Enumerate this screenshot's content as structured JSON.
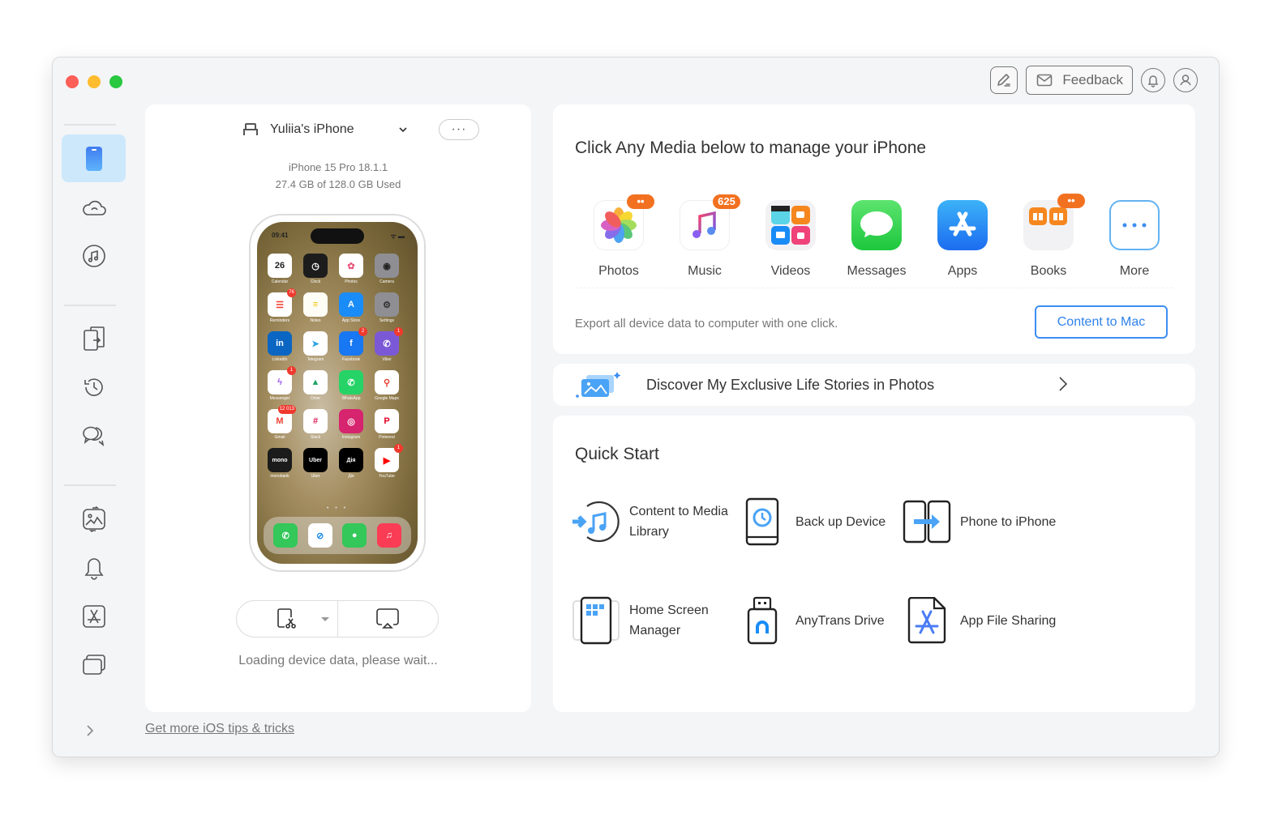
{
  "window": {
    "controls": [
      "close",
      "minimize",
      "maximize"
    ]
  },
  "toolbar": {
    "edit_icon": "edit-note-icon",
    "feedback_label": "Feedback",
    "feedback_icon": "mail-icon",
    "notifications_icon": "bell-icon",
    "account_icon": "user-icon"
  },
  "sidebar": {
    "items": [
      {
        "id": "device-manager",
        "icon": "phone-icon",
        "active": true
      },
      {
        "id": "icloud-manager",
        "icon": "cloud-icon",
        "active": false
      },
      {
        "id": "itunes-library",
        "icon": "music-circle-icon",
        "active": false
      },
      {
        "id": "phone-switcher",
        "icon": "phone-transfer-icon",
        "active": false
      },
      {
        "id": "backup-manager",
        "icon": "history-icon",
        "active": false
      },
      {
        "id": "social-messages",
        "icon": "chat-bubbles-icon",
        "active": false
      },
      {
        "id": "heic-converter",
        "icon": "photo-convert-icon",
        "active": false
      },
      {
        "id": "ringtone-maker",
        "icon": "bell-icon",
        "active": false
      },
      {
        "id": "app-downloader",
        "icon": "app-store-icon",
        "active": false
      },
      {
        "id": "screen-mirroring",
        "icon": "windows-stack-icon",
        "active": false
      }
    ],
    "expand_icon": "chevron-right-icon"
  },
  "device": {
    "name": "Yuliia's iPhone",
    "model": "iPhone 15 Pro 18.1.1",
    "storage": "27.4 GB of  128.0 GB Used",
    "more_label": "···",
    "loading_text": "Loading device data, please wait...",
    "screen": {
      "time": "09:41",
      "apps": [
        {
          "name": "Calendar",
          "glyph": "26",
          "bg": "#ffffff",
          "fg": "#222",
          "badge": null
        },
        {
          "name": "Clock",
          "glyph": "◷",
          "bg": "#1c1c1c",
          "fg": "#fff",
          "badge": null
        },
        {
          "name": "Photos",
          "glyph": "✿",
          "bg": "#ffffff",
          "fg": "#e8547a",
          "badge": null
        },
        {
          "name": "Camera",
          "glyph": "◉",
          "bg": "#8e8e93",
          "fg": "#222",
          "badge": null
        },
        {
          "name": "Reminders",
          "glyph": "☰",
          "bg": "#ffffff",
          "fg": "#f0392e",
          "badge": "76"
        },
        {
          "name": "Notes",
          "glyph": "≡",
          "bg": "#fdfdf5",
          "fg": "#f5c400",
          "badge": null
        },
        {
          "name": "App Store",
          "glyph": "A",
          "bg": "#1a8cf7",
          "fg": "#fff",
          "badge": null
        },
        {
          "name": "Settings",
          "glyph": "⚙",
          "bg": "#8e8e93",
          "fg": "#333",
          "badge": null
        },
        {
          "name": "LinkedIn",
          "glyph": "in",
          "bg": "#0a66c2",
          "fg": "#fff",
          "badge": null
        },
        {
          "name": "Telegram",
          "glyph": "➤",
          "bg": "#ffffff",
          "fg": "#2aa3e0",
          "badge": null
        },
        {
          "name": "Facebook",
          "glyph": "f",
          "bg": "#1877f2",
          "fg": "#fff",
          "badge": "2"
        },
        {
          "name": "Viber",
          "glyph": "✆",
          "bg": "#7b59d6",
          "fg": "#fff",
          "badge": "1"
        },
        {
          "name": "Messenger",
          "glyph": "ϟ",
          "bg": "#ffffff",
          "fg": "#a05cf0",
          "badge": "1"
        },
        {
          "name": "Drive",
          "glyph": "▲",
          "bg": "#ffffff",
          "fg": "#1fa463",
          "badge": null
        },
        {
          "name": "WhatsApp",
          "glyph": "✆",
          "bg": "#25d366",
          "fg": "#fff",
          "badge": null
        },
        {
          "name": "Google Maps",
          "glyph": "⚲",
          "bg": "#ffffff",
          "fg": "#e94235",
          "badge": null
        },
        {
          "name": "Gmail",
          "glyph": "M",
          "bg": "#ffffff",
          "fg": "#ea4335",
          "badge": "12 013"
        },
        {
          "name": "Slack",
          "glyph": "#",
          "bg": "#ffffff",
          "fg": "#e01e5a",
          "badge": null
        },
        {
          "name": "Instagram",
          "glyph": "◎",
          "bg": "#d6246e",
          "fg": "#fff",
          "badge": null
        },
        {
          "name": "Pinterest",
          "glyph": "P",
          "bg": "#ffffff",
          "fg": "#e60023",
          "badge": null
        },
        {
          "name": "monobank",
          "glyph": "mono",
          "bg": "#1b1b1b",
          "fg": "#fff",
          "badge": null
        },
        {
          "name": "Uber",
          "glyph": "Uber",
          "bg": "#000000",
          "fg": "#fff",
          "badge": null
        },
        {
          "name": "Дія",
          "glyph": "Дія",
          "bg": "#000000",
          "fg": "#fff",
          "badge": null
        },
        {
          "name": "YouTube",
          "glyph": "▶",
          "bg": "#ffffff",
          "fg": "#ff0000",
          "badge": "1"
        }
      ],
      "dock": [
        {
          "name": "Phone",
          "glyph": "✆",
          "bg": "#34c759",
          "fg": "#fff"
        },
        {
          "name": "Safari",
          "glyph": "⊘",
          "bg": "#ffffff",
          "fg": "#1a8cf7"
        },
        {
          "name": "Messages",
          "glyph": "●",
          "bg": "#34c759",
          "fg": "#fff"
        },
        {
          "name": "Music",
          "glyph": "♫",
          "bg": "#fa3c55",
          "fg": "#fff"
        }
      ],
      "page_dots": "• • •"
    },
    "actions": [
      {
        "id": "screenshot",
        "icon": "screenshot-scissors-icon",
        "has_dropdown": true
      },
      {
        "id": "screen-mirror",
        "icon": "airplay-icon",
        "has_dropdown": false
      }
    ]
  },
  "footer": {
    "tips_link": "Get more iOS tips & tricks"
  },
  "media": {
    "title": "Click Any Media below to manage your iPhone",
    "items": [
      {
        "label": "Photos",
        "icon": "photos-icon",
        "badge": "••"
      },
      {
        "label": "Music",
        "icon": "music-note-icon",
        "badge": "625"
      },
      {
        "label": "Videos",
        "icon": "videos-icon",
        "badge": null
      },
      {
        "label": "Messages",
        "icon": "messages-icon",
        "badge": null
      },
      {
        "label": "Apps",
        "icon": "apps-icon",
        "badge": null
      },
      {
        "label": "Books",
        "icon": "books-icon",
        "badge": "••"
      },
      {
        "label": "More",
        "icon": "more-dots-icon",
        "badge": null
      }
    ],
    "export_text": "Export all device data to computer with one click.",
    "export_button": "Content to Mac",
    "accent_color": "#3d8ef2",
    "badge_color": "#f27121"
  },
  "discover": {
    "text": "Discover My Exclusive Life Stories in Photos"
  },
  "quick_start": {
    "title": "Quick Start",
    "items": [
      {
        "label_1": "Content to Media",
        "label_2": "Library",
        "icon": "content-to-media-library-icon"
      },
      {
        "label_1": "Back up Device",
        "label_2": "",
        "icon": "backup-device-icon"
      },
      {
        "label_1": "Phone to iPhone",
        "label_2": "",
        "icon": "phone-to-iphone-icon"
      },
      {
        "label_1": "Home Screen",
        "label_2": "Manager",
        "icon": "home-screen-manager-icon"
      },
      {
        "label_1": "AnyTrans Drive",
        "label_2": "",
        "icon": "usb-drive-icon"
      },
      {
        "label_1": "App File Sharing",
        "label_2": "",
        "icon": "app-file-icon"
      }
    ]
  }
}
